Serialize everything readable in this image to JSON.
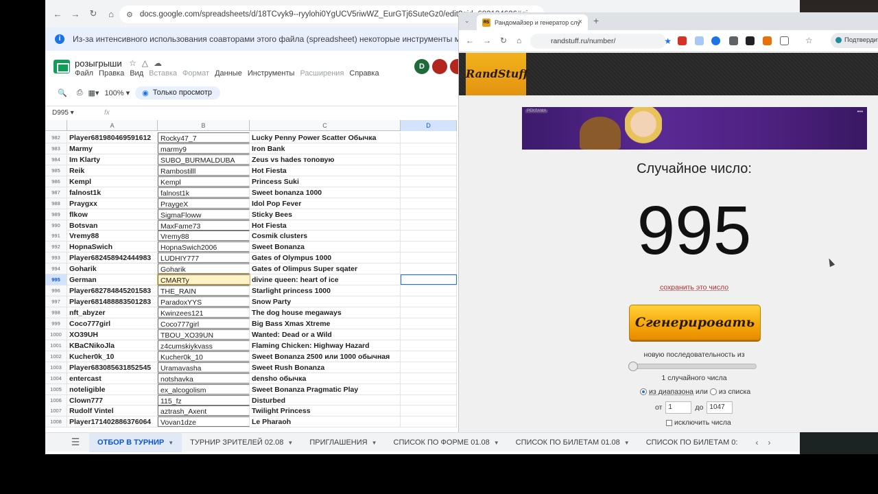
{
  "sheets": {
    "url": "docs.google.com/spreadsheets/d/18TCvyk9--ryylohi0YgUCV5riwWZ_EurGTj6SuteGz0/edit?gid=682134626#gi",
    "info_message": "Из-за интенсивного использования соавторами этого файла (spreadsheet) некоторые инструменты могут быть недоступны.",
    "doc_title": "розыгрыши",
    "menu": [
      {
        "label": "Файл",
        "enabled": true
      },
      {
        "label": "Правка",
        "enabled": true
      },
      {
        "label": "Вид",
        "enabled": true
      },
      {
        "label": "Вставка",
        "enabled": false
      },
      {
        "label": "Формат",
        "enabled": false
      },
      {
        "label": "Данные",
        "enabled": true
      },
      {
        "label": "Инструменты",
        "enabled": true
      },
      {
        "label": "Расширения",
        "enabled": false
      },
      {
        "label": "Справка",
        "enabled": true
      }
    ],
    "avatars": [
      {
        "letter": "D",
        "color": "#1e6b3a"
      },
      {
        "letter": "",
        "color": "#b3261e"
      },
      {
        "letter": "",
        "color": "#b3261e"
      }
    ],
    "zoom": "100%",
    "view_only_label": "Только просмотр",
    "cell_ref": "D995",
    "fx": "fx",
    "columns": [
      "A",
      "B",
      "C",
      "D"
    ],
    "selected_row": "995",
    "rows": [
      {
        "n": "982",
        "a": "Player681980469591612",
        "b": "Rocky47_7",
        "c": "Lucky Penny Power Scatter Обычка"
      },
      {
        "n": "983",
        "a": "Marmy",
        "b": "marmy9",
        "c": "Iron Bank"
      },
      {
        "n": "984",
        "a": "Im Klarty",
        "b": "SUBO_BURMALDUBA",
        "c": "Zeus vs hades топовую"
      },
      {
        "n": "985",
        "a": "Reik",
        "b": "Rambostilll",
        "c": "Hot Fiesta"
      },
      {
        "n": "986",
        "a": "Kempl",
        "b": "Kempl",
        "c": "Princess Suki"
      },
      {
        "n": "987",
        "a": "falnost1k",
        "b": "falnost1k",
        "c": "Sweet bonanza 1000"
      },
      {
        "n": "988",
        "a": "Praygxx",
        "b": "PraygeX",
        "c": "Idol Pop Fever"
      },
      {
        "n": "989",
        "a": "flkow",
        "b": "SigmaFloww",
        "c": "Sticky Bees"
      },
      {
        "n": "990",
        "a": "Botsvan",
        "b": "MaxFame73",
        "c": "Hot Fiesta"
      },
      {
        "n": "991",
        "a": "Vremy88",
        "b": "Vremy88",
        "c": "Cosmik clusters"
      },
      {
        "n": "992",
        "a": "HopnaSwich",
        "b": "HopnaSwich2006",
        "c": "Sweet Bonanza"
      },
      {
        "n": "993",
        "a": "Player682458942444983",
        "b": "LUDHIY777",
        "c": "Gates of Olympus 1000"
      },
      {
        "n": "994",
        "a": "Goharik",
        "b": "Goharik",
        "c": "Gates of Olimpus Super sqater"
      },
      {
        "n": "995",
        "a": "German",
        "b": "CMARTy",
        "c": "divine queen: heart of ice"
      },
      {
        "n": "996",
        "a": "Player682784845201583",
        "b": "THE_RAIN",
        "c": "Starlight princess 1000"
      },
      {
        "n": "997",
        "a": "Player681488883501283",
        "b": "ParadoxYYS",
        "c": "Snow Party"
      },
      {
        "n": "998",
        "a": "nft_abyzer",
        "b": "Kwinzees121",
        "c": "The dog house megaways"
      },
      {
        "n": "999",
        "a": "Coco777girl",
        "b": "Coco777girl",
        "c": "Big Bass Xmas Xtreme"
      },
      {
        "n": "1000",
        "a": "XO39UH",
        "b": "TBOU_XO39UN",
        "c": "Wanted: Dead or a Wild"
      },
      {
        "n": "1001",
        "a": "KBaCNikoJla",
        "b": "z4cumskiykvass",
        "c": "Flaming Chicken: Highway Hazard"
      },
      {
        "n": "1002",
        "a": "Kucher0k_10",
        "b": "Kucher0k_10",
        "c": "Sweet Bonanza 2500 или 1000 обычная"
      },
      {
        "n": "1003",
        "a": "Player683085631852545",
        "b": "Uramavasha",
        "c": "Sweet Rush Bonanza"
      },
      {
        "n": "1004",
        "a": "entercast",
        "b": "notshavka",
        "c": "densho обычка"
      },
      {
        "n": "1005",
        "a": "noteligible",
        "b": "ex_alcogolism",
        "c": "Sweet Bonanza  Pragmatic Play"
      },
      {
        "n": "1006",
        "a": "Clown777",
        "b": "115_fz",
        "c": "Disturbed"
      },
      {
        "n": "1007",
        "a": "Rudolf Vintel",
        "b": "aztrash_Axent",
        "c": "Twilight Princess"
      },
      {
        "n": "1008",
        "a": "Player171402886376064",
        "b": "Vovan1dze",
        "c": "Le Pharaoh"
      }
    ],
    "tabs": [
      "ОТБОР В ТУРНИР",
      "ТУРНИР ЗРИТЕЛЕЙ 02.08",
      "ПРИГЛАШЕНИЯ",
      "СПИСОК ПО ФОРМЕ 01.08",
      "СПИСОК ПО БИЛЕТАМ 01.08",
      "СПИСОК ПО БИЛЕТАМ 0:"
    ],
    "active_tab": "ОТБОР В ТУРНИР"
  },
  "randstuff": {
    "tab_title": "Рандомайзер и генератор слу",
    "url": "randstuff.ru/number/",
    "confirm_label": "Подтвердите",
    "logo": "RandStuff",
    "ad_label": "РЕКЛАМА",
    "heading": "Случайное число:",
    "number": "995",
    "save_link": "сохранить это число",
    "generate_button": "Сгенерировать",
    "sequence_label": "новую последовательность из",
    "count_label": "1 случайного числа",
    "mode_range": "из диапазона",
    "mode_or": "или",
    "mode_list": "из списка",
    "from_label": "от",
    "from_value": "1",
    "to_label": "до",
    "to_value": "1047",
    "exclude_label": "исключить числа"
  }
}
